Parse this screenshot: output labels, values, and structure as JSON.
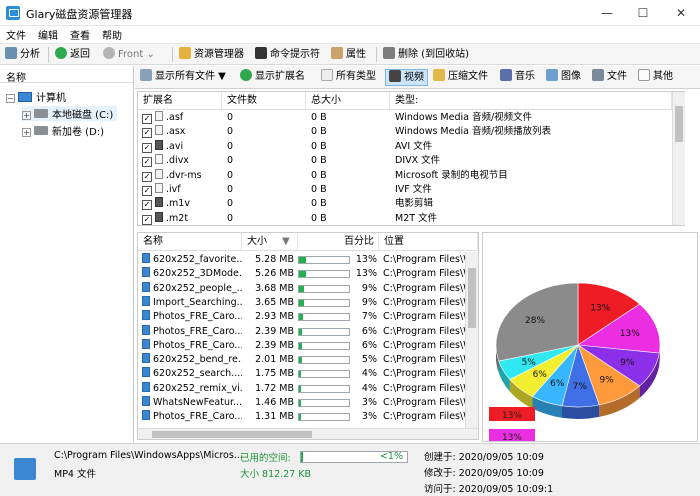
{
  "window": {
    "title": "Glary磁盘资源管理器"
  },
  "menu": [
    "文件",
    "编辑",
    "查看",
    "帮助"
  ],
  "toolbar": {
    "analyze": "分析",
    "back": "返回",
    "front": "Front",
    "explorer": "资源管理器",
    "cmd": "命令提示符",
    "props": "属性",
    "delete": "删除 (到回收站)"
  },
  "tree": {
    "header": "名称",
    "computer": "计算机",
    "drives": [
      "本地磁盘 (C:)",
      "新加卷 (D:)"
    ]
  },
  "filters": {
    "show_all": "显示所有文件",
    "show_ext": "显示扩展名",
    "types": [
      "所有类型",
      "视频",
      "压缩文件",
      "音乐",
      "图像",
      "文件",
      "其他"
    ],
    "selected": "视频"
  },
  "ext_table": {
    "columns": [
      "扩展名",
      "文件数",
      "总大小",
      "类型:"
    ],
    "rows": [
      {
        "ext": ".asf",
        "count": "0",
        "size": "0 B",
        "type": "Windows Media 音频/视频文件"
      },
      {
        "ext": ".asx",
        "count": "0",
        "size": "0 B",
        "type": "Windows Media 音频/视频播放列表"
      },
      {
        "ext": ".avi",
        "count": "0",
        "size": "0 B",
        "type": "AVI 文件"
      },
      {
        "ext": ".divx",
        "count": "0",
        "size": "0 B",
        "type": "DIVX 文件"
      },
      {
        "ext": ".dvr-ms",
        "count": "0",
        "size": "0 B",
        "type": "Microsoft 录制的电视节目"
      },
      {
        "ext": ".ivf",
        "count": "0",
        "size": "0 B",
        "type": "IVF 文件"
      },
      {
        "ext": ".m1v",
        "count": "0",
        "size": "0 B",
        "type": "电影剪辑"
      },
      {
        "ext": ".m2t",
        "count": "0",
        "size": "0 B",
        "type": "M2T 文件"
      }
    ]
  },
  "file_table": {
    "columns": [
      "名称",
      "大小",
      "百分比",
      "位置"
    ],
    "rows": [
      {
        "name": "620x252_favorite...",
        "size": "5.28 MB",
        "pct": "13%",
        "frac": 0.13,
        "loc": "C:\\Program Files\\W"
      },
      {
        "name": "620x252_3DMode...",
        "size": "5.26 MB",
        "pct": "13%",
        "frac": 0.13,
        "loc": "C:\\Program Files\\W"
      },
      {
        "name": "620x252_people_...",
        "size": "3.68 MB",
        "pct": "9%",
        "frac": 0.09,
        "loc": "C:\\Program Files\\W"
      },
      {
        "name": "Import_Searching...",
        "size": "3.65 MB",
        "pct": "9%",
        "frac": 0.09,
        "loc": "C:\\Program Files\\W"
      },
      {
        "name": "Photos_FRE_Caro...",
        "size": "2.93 MB",
        "pct": "7%",
        "frac": 0.07,
        "loc": "C:\\Program Files\\W"
      },
      {
        "name": "Photos_FRE_Caro...",
        "size": "2.39 MB",
        "pct": "6%",
        "frac": 0.06,
        "loc": "C:\\Program Files\\W"
      },
      {
        "name": "Photos_FRE_Caro...",
        "size": "2.39 MB",
        "pct": "6%",
        "frac": 0.06,
        "loc": "C:\\Program Files\\W"
      },
      {
        "name": "620x252_bend_re...",
        "size": "2.01 MB",
        "pct": "5%",
        "frac": 0.05,
        "loc": "C:\\Program Files\\W"
      },
      {
        "name": "620x252_search....",
        "size": "1.75 MB",
        "pct": "4%",
        "frac": 0.04,
        "loc": "C:\\Program Files\\W"
      },
      {
        "name": "620x252_remix_vi...",
        "size": "1.72 MB",
        "pct": "4%",
        "frac": 0.04,
        "loc": "C:\\Program Files\\W"
      },
      {
        "name": "WhatsNewFeatur...",
        "size": "1.46 MB",
        "pct": "3%",
        "frac": 0.03,
        "loc": "C:\\Program Files\\W"
      },
      {
        "name": "Photos_FRE_Caro...",
        "size": "1.31 MB",
        "pct": "3%",
        "frac": 0.03,
        "loc": "C:\\Program Files\\W"
      }
    ]
  },
  "pie": {
    "slices": [
      {
        "label": "13%",
        "value": 13,
        "color": "#ee1c24"
      },
      {
        "label": "13%",
        "value": 13,
        "color": "#ec2ee2"
      },
      {
        "label": "9%",
        "value": 9,
        "color": "#8c2fe8"
      },
      {
        "label": "9%",
        "value": 9,
        "color": "#ff9a3c"
      },
      {
        "label": "7%",
        "value": 7,
        "color": "#3f6fe6"
      },
      {
        "label": "6%",
        "value": 6,
        "color": "#38b6ff"
      },
      {
        "label": "6%",
        "value": 6,
        "color": "#f4ee30"
      },
      {
        "label": "5%",
        "value": 5,
        "color": "#2fe8f2"
      },
      {
        "label": "28%",
        "value": 28,
        "color": "#8b8b8b"
      }
    ],
    "legend": [
      "13%",
      "13%"
    ]
  },
  "status": {
    "path": "C:\\Program Files\\WindowsApps\\Micros...",
    "filetype": "MP4 文件",
    "used_label": "已用的空间:",
    "used_pct": "<1%",
    "used_frac": 0.01,
    "size_label": "大小 812.27 KB",
    "created": "创建于: 2020/09/05 10:09",
    "modified": "修改于: 2020/09/05 10:09",
    "accessed": "访问于: 2020/09/05 10:09:1"
  }
}
